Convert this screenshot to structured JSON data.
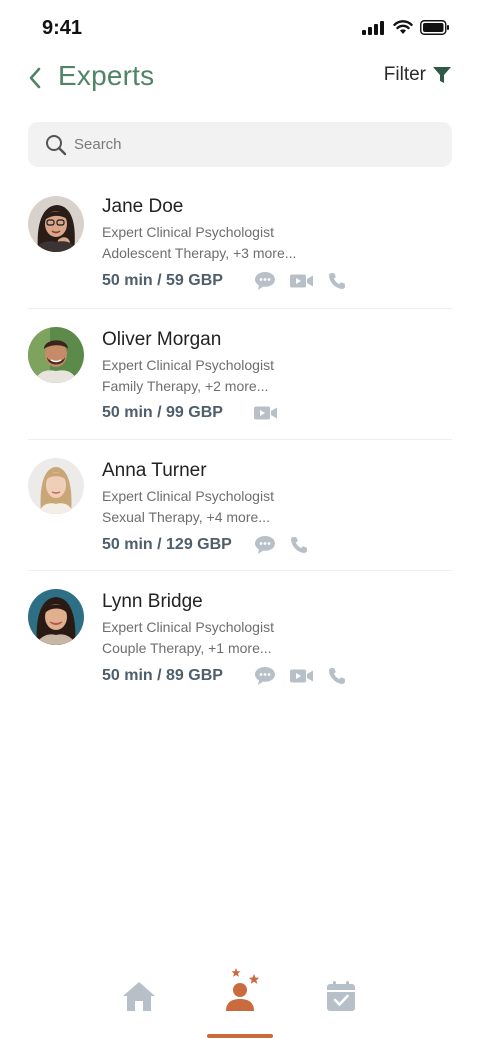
{
  "status_bar": {
    "time": "9:41"
  },
  "header": {
    "title": "Experts",
    "filter_label": "Filter"
  },
  "search": {
    "placeholder": "Search"
  },
  "experts": [
    {
      "name": "Jane Doe",
      "role": "Expert Clinical Psychologist",
      "specialty": "Adolescent Therapy, +3 more...",
      "price": "50 min / 59 GBP",
      "services": [
        "chat",
        "video",
        "phone"
      ]
    },
    {
      "name": "Oliver Morgan",
      "role": "Expert Clinical Psychologist",
      "specialty": "Family Therapy, +2 more...",
      "price": "50 min / 99 GBP",
      "services": [
        "video"
      ]
    },
    {
      "name": "Anna Turner",
      "role": "Expert Clinical Psychologist",
      "specialty": "Sexual Therapy, +4 more...",
      "price": "50 min / 129 GBP",
      "services": [
        "chat",
        "phone"
      ]
    },
    {
      "name": "Lynn Bridge",
      "role": "Expert Clinical Psychologist",
      "specialty": "Couple Therapy, +1 more...",
      "price": "50 min / 89 GBP",
      "services": [
        "chat",
        "video",
        "phone"
      ]
    }
  ],
  "tabbar": {
    "tabs": [
      "home-icon",
      "experts-icon",
      "calendar-icon"
    ],
    "active": "experts"
  },
  "colors": {
    "accent_green": "#4f8466",
    "accent_orange": "#c96a3f",
    "icon_grey": "#b7c0c8"
  }
}
